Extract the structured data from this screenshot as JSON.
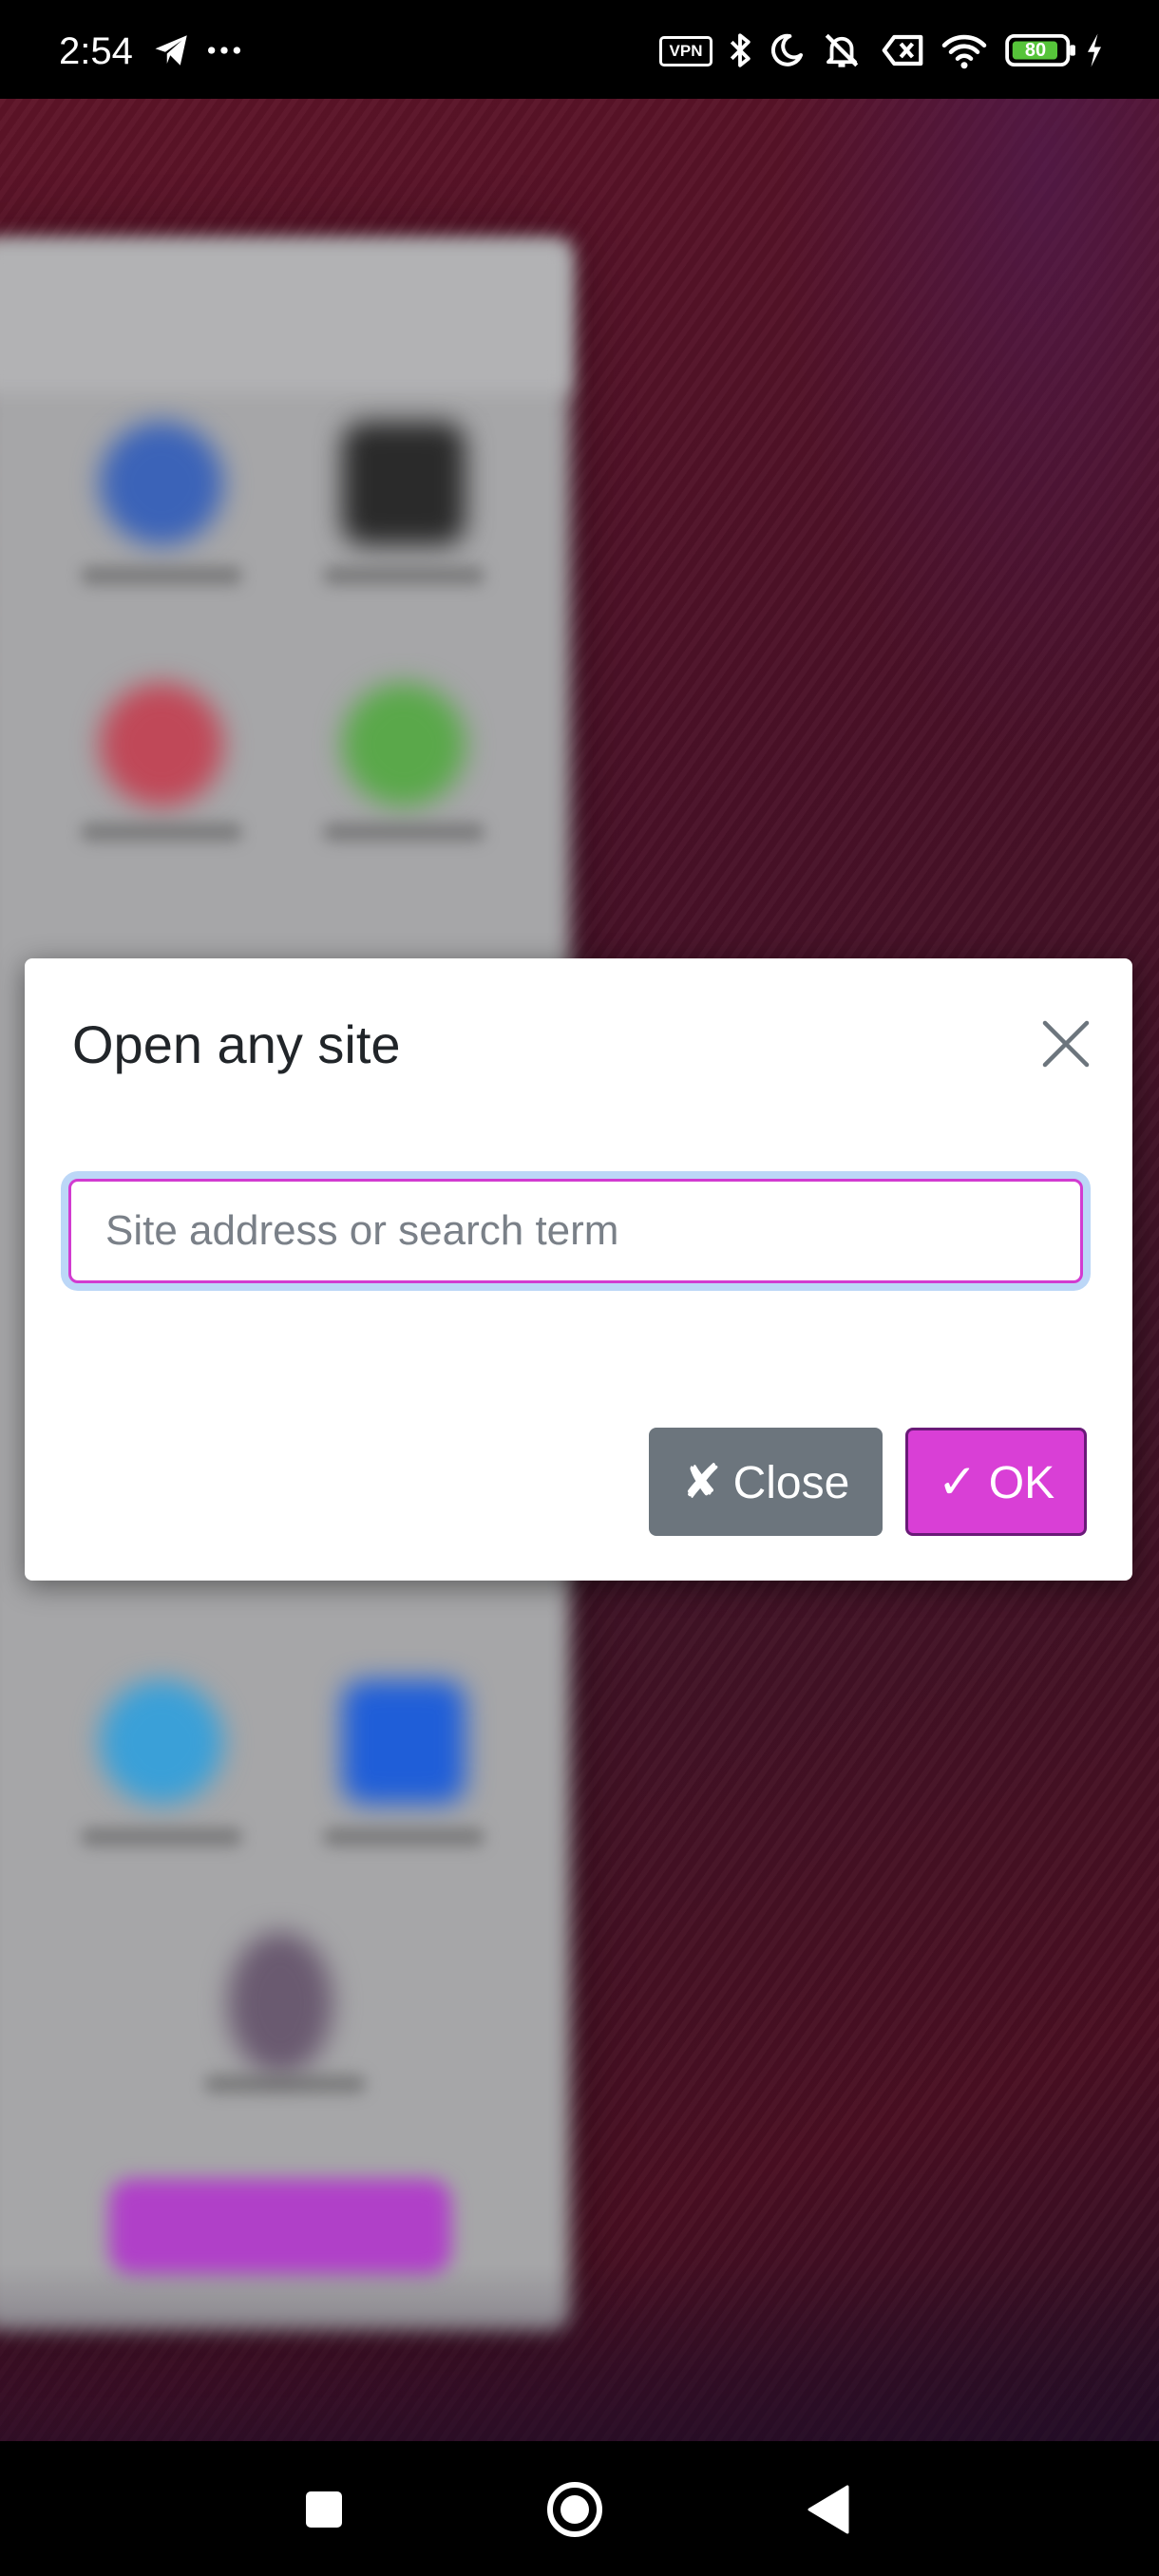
{
  "status_bar": {
    "time": "2:54",
    "vpn_label": "VPN",
    "battery_level": "80",
    "icons": [
      "telegram-icon",
      "more-dots-icon",
      "vpn-icon",
      "bluetooth-icon",
      "moon-icon",
      "mute-icon",
      "sim-icon",
      "wifi-icon",
      "battery-icon",
      "charging-icon"
    ]
  },
  "dialog": {
    "title": "Open any site",
    "input": {
      "value": "",
      "placeholder": "Site address or search term"
    },
    "close_button": {
      "icon": "✘",
      "label": "Close"
    },
    "ok_button": {
      "icon": "✓",
      "label": "OK"
    }
  },
  "colors": {
    "ok_accent": "#d93fd6",
    "close_button": "#6c757d",
    "input_border": "#d23bd0",
    "focus_ring": "#bcd7f7"
  },
  "nav_bar": {
    "buttons": [
      "recents-square-icon",
      "home-circle-icon",
      "back-triangle-icon"
    ]
  }
}
